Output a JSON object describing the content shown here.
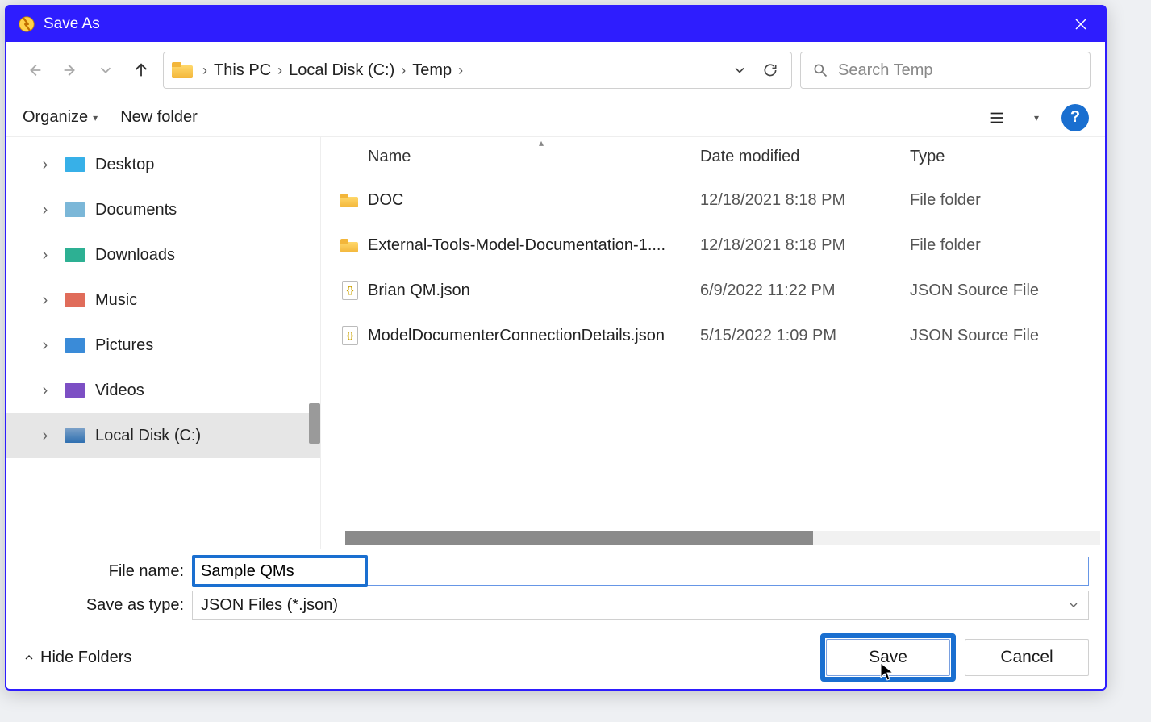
{
  "window": {
    "title": "Save As"
  },
  "nav": {
    "breadcrumbs": [
      "This PC",
      "Local Disk (C:)",
      "Temp"
    ],
    "search_placeholder": "Search Temp"
  },
  "toolbar": {
    "organize": "Organize",
    "new_folder": "New folder"
  },
  "navpane": {
    "items": [
      {
        "label": "Desktop",
        "color": "#37b0e8"
      },
      {
        "label": "Documents",
        "color": "#7bb7d8"
      },
      {
        "label": "Downloads",
        "color": "#2db093"
      },
      {
        "label": "Music",
        "color": "#e06c5a"
      },
      {
        "label": "Pictures",
        "color": "#3a8bd8"
      },
      {
        "label": "Videos",
        "color": "#7c4fc4"
      },
      {
        "label": "Local Disk (C:)",
        "color": "#2f6fb0",
        "selected": true
      }
    ]
  },
  "columns": {
    "name": "Name",
    "date": "Date modified",
    "type": "Type"
  },
  "files": [
    {
      "name": "DOC",
      "date": "12/18/2021 8:18 PM",
      "type": "File folder",
      "kind": "folder"
    },
    {
      "name": "External-Tools-Model-Documentation-1....",
      "date": "12/18/2021 8:18 PM",
      "type": "File folder",
      "kind": "folder"
    },
    {
      "name": "Brian QM.json",
      "date": "6/9/2022 11:22 PM",
      "type": "JSON Source File",
      "kind": "json"
    },
    {
      "name": "ModelDocumenterConnectionDetails.json",
      "date": "5/15/2022 1:09 PM",
      "type": "JSON Source File",
      "kind": "json"
    }
  ],
  "fields": {
    "filename_label": "File name:",
    "filename_value": "Sample QMs",
    "filetype_label": "Save as type:",
    "filetype_value": "JSON Files (*.json)"
  },
  "footer": {
    "hide_folders": "Hide Folders",
    "save": "Save",
    "cancel": "Cancel"
  }
}
